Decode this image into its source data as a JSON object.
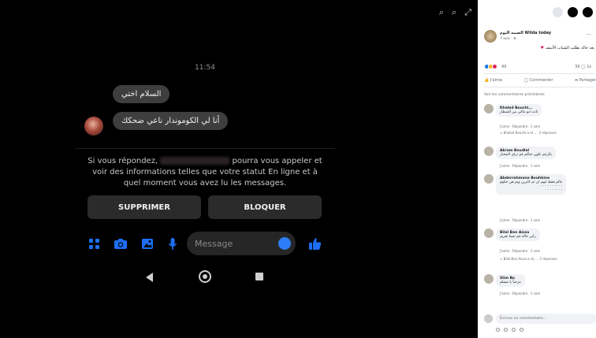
{
  "viewer": {
    "tools": [
      "⌕",
      "⌕",
      "⤢"
    ]
  },
  "phone": {
    "time": "11:54",
    "messages": [
      "السلام اختي",
      "أنا لي الكوموندار ناعي ضحكك"
    ],
    "notice_part1": "Si vous répondez,",
    "notice_part2": "pourra vous appeler et voir des informations telles que votre statut En ligne et à quel moment vous avez lu les messages.",
    "delete_label": "SUPPRIMER",
    "block_label": "BLOQUER",
    "message_placeholder": "Message",
    "colors": {
      "accent": "#1d6ff2"
    }
  },
  "panel": {
    "post": {
      "name": "الصيبة اليوم Wilda today",
      "meta": "7 aoû · ⊕",
      "text": "بعد حالة بطلب الشباب الأسف",
      "reaction_count": "49",
      "comment_count": "39 ◯  1s",
      "actions": [
        "J'aime",
        "Commenter",
        "Partager"
      ],
      "view_previous": "Voir les commentaires précédents"
    },
    "comments": [
      {
        "name": "Khaled Bouchl...",
        "text": "تانت ابو ماكي بين الشطار",
        "actions": "J'aime · Répondre · 1 sem",
        "reply": "↳ Khaled Bouchl a ré... · 2 réponses"
      },
      {
        "name": "Akram Boudlal",
        "text": "بالرعم تكون حتاكم قم تراي المختار",
        "actions": "J'aime · Répondre · 1 sem",
        "reply": ""
      },
      {
        "name": "Abderrahmane Bouhbine",
        "text": "عالم فقط انهم ان تم كابرين وتم هن حكوم",
        "actions": "J'aime · Répondre · 1 sem",
        "reply": ""
      },
      {
        "name": "Bilal Ben Aissa",
        "text": "راني حالة غم عبينا تعزيم",
        "actions": "J'aime · Répondre · 1 sem",
        "reply": "↳ Bilal Ben Aissa a ré... · 2 réponses"
      },
      {
        "name": "Slim Bo",
        "text": "مرحباً يا مسلم",
        "actions": "J'aime · Répondre · 1 sem",
        "reply": ""
      }
    ],
    "write_placeholder": "Écrivez un commentaire..."
  }
}
